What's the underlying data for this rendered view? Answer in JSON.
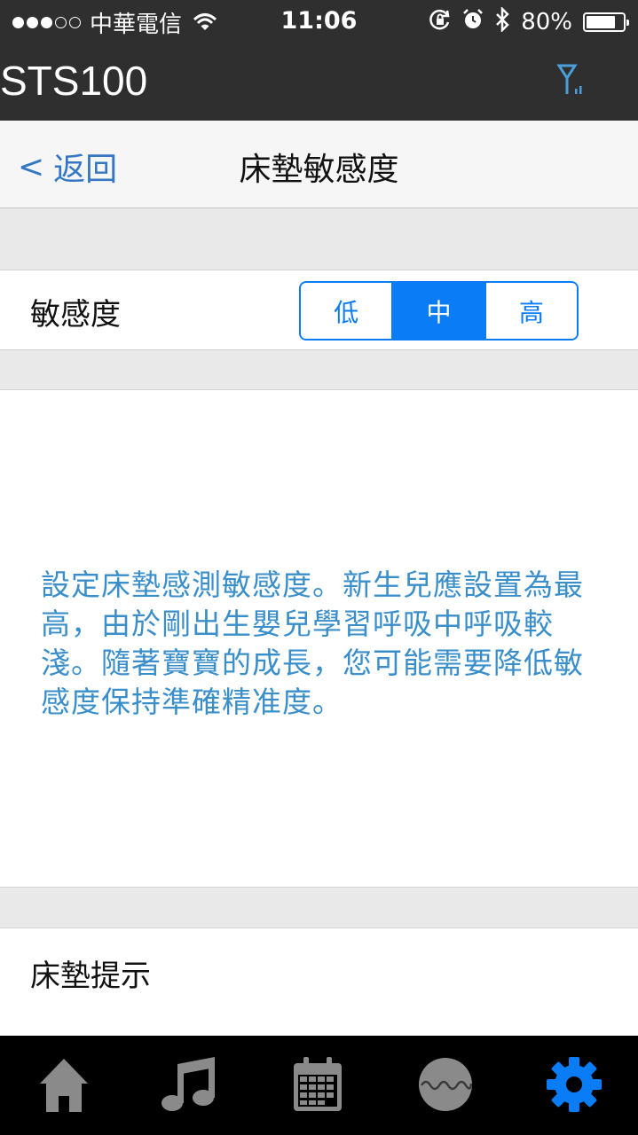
{
  "status_bar": {
    "carrier": "中華電信",
    "time": "11:06",
    "battery": "80%",
    "battery_level": 0.8
  },
  "app_header": {
    "title": "STS100",
    "icon": "antenna-signal-icon"
  },
  "nav_bar": {
    "back_label": "返回",
    "back_chevron": "<",
    "title": "床墊敏感度"
  },
  "sensitivity": {
    "label": "敏感度",
    "options": [
      "低",
      "中",
      "高"
    ],
    "selected": "中"
  },
  "description": "設定床墊感測敏感度。新生兒應設置為最高，由於剛出生嬰兒學習呼吸中呼吸較淺。隨著寶寶的成長，您可能需要降低敏感度保持準確精准度。",
  "mattress_hint": {
    "label": "床墊提示"
  },
  "tab_bar": {
    "tabs": [
      {
        "icon": "home-icon",
        "active": false
      },
      {
        "icon": "music-note-icon",
        "active": false
      },
      {
        "icon": "calendar-icon",
        "active": false
      },
      {
        "icon": "waveform-icon",
        "active": false
      },
      {
        "icon": "gear-icon",
        "active": true
      }
    ],
    "active_color": "#0a7cf5",
    "inactive_color": "#8a8a8a"
  }
}
